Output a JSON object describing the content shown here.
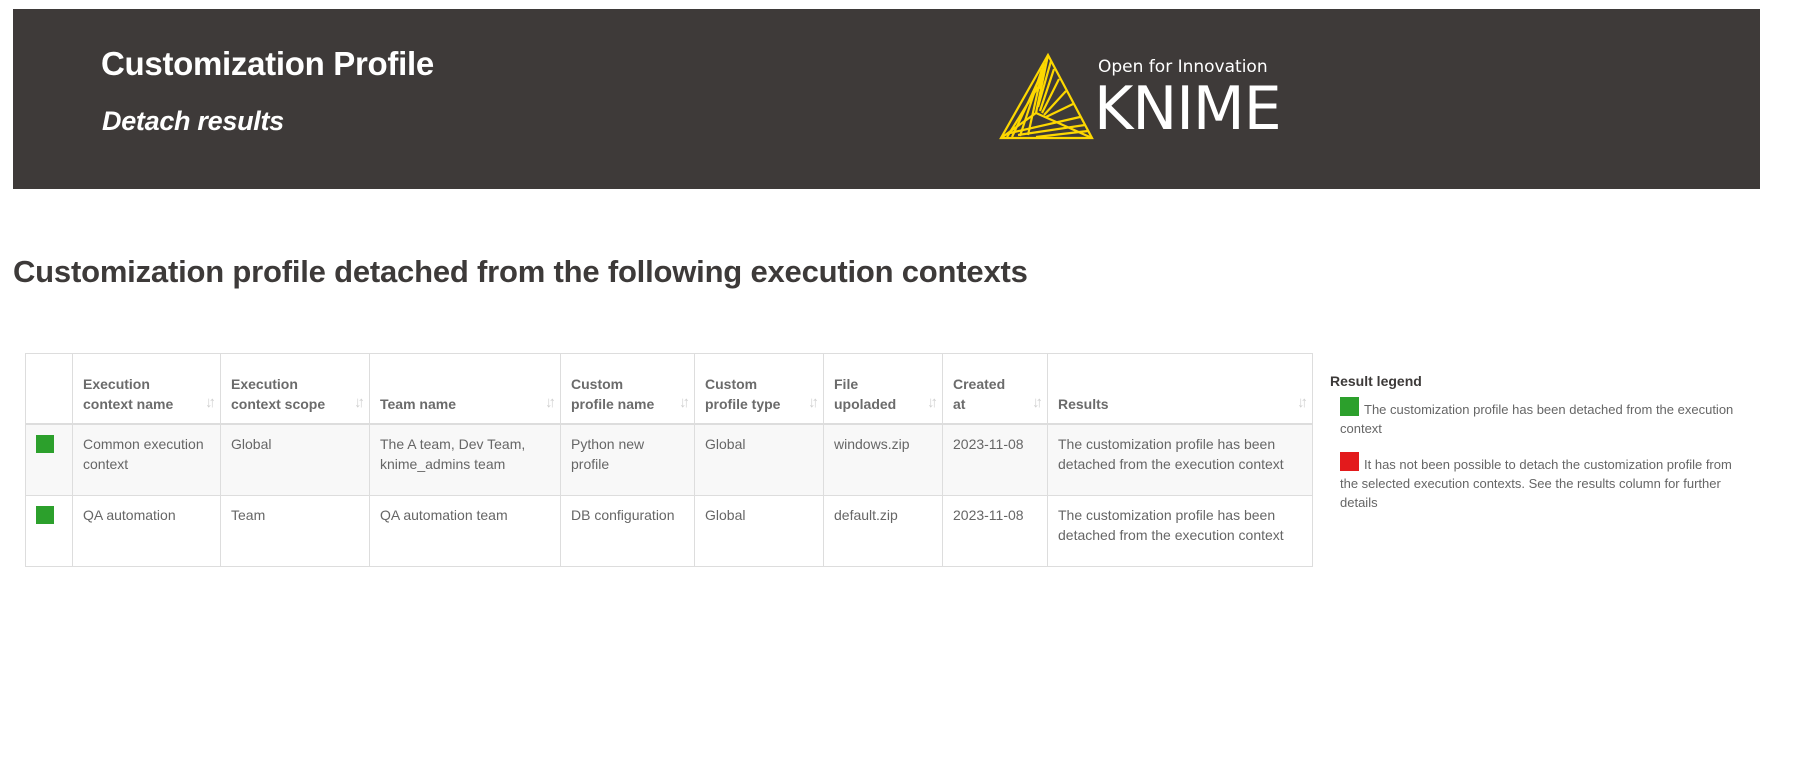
{
  "header": {
    "title": "Customization Profile",
    "subtitle": "Detach results",
    "background_color": "#3e3a39",
    "logo": {
      "icon": "knime-triangle-logo-icon",
      "tagline": "Open for Innovation",
      "wordmark": "KNIME",
      "accent_color": "#fdd800"
    }
  },
  "main": {
    "heading": "Customization profile detached from the following execution contexts",
    "table": {
      "sort_icon": "sort-arrows-icon",
      "sort_glyph": "↓↑",
      "columns": [
        {
          "key": "status",
          "label": ""
        },
        {
          "key": "execution_context_name",
          "label": "Execution context name"
        },
        {
          "key": "execution_context_scope",
          "label": "Execution context scope"
        },
        {
          "key": "team_name",
          "label": "Team name"
        },
        {
          "key": "custom_profile_name",
          "label": "Custom profile name"
        },
        {
          "key": "custom_profile_type",
          "label": "Custom profile type"
        },
        {
          "key": "file_uploaded",
          "label": "File upoladed"
        },
        {
          "key": "created_at",
          "label": "Created at"
        },
        {
          "key": "results",
          "label": "Results"
        }
      ],
      "rows": [
        {
          "status": "success",
          "status_color": "#2ca02c",
          "execution_context_name": "Common execution context",
          "execution_context_scope": "Global",
          "team_name": "The A team, Dev Team, knime_admins team",
          "custom_profile_name": "Python new profile",
          "custom_profile_type": "Global",
          "file_uploaded": "windows.zip",
          "created_at": "2023-11-08",
          "results": "The customization profile has been detached from the execution context"
        },
        {
          "status": "success",
          "status_color": "#2ca02c",
          "execution_context_name": "QA automation",
          "execution_context_scope": "Team",
          "team_name": "QA automation team",
          "custom_profile_name": "DB configuration",
          "custom_profile_type": "Global",
          "file_uploaded": "default.zip",
          "created_at": "2023-11-08",
          "results": "The customization profile has been detached from the execution context"
        }
      ]
    },
    "legend": {
      "title": "Result legend",
      "items": [
        {
          "color": "#2ca02c",
          "text": "The customization profile has been detached from the execution context"
        },
        {
          "color": "#e31a1c",
          "text": "It has not been possible to detach the customization profile from the selected execution contexts. See the results column for further details"
        }
      ]
    }
  }
}
